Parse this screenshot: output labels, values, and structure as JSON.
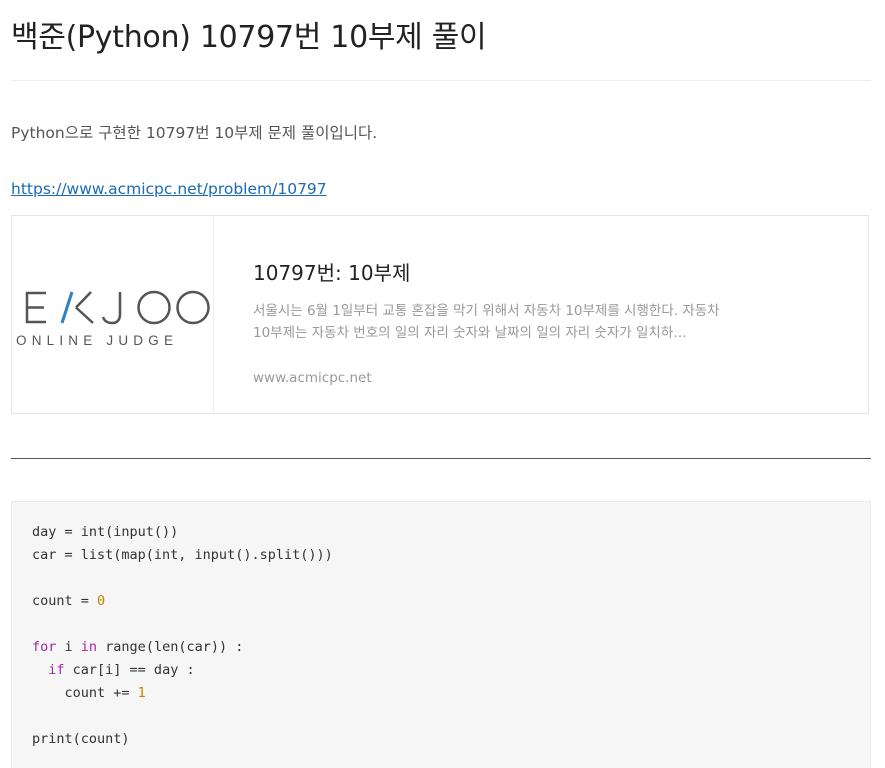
{
  "post": {
    "title": "백준(Python) 10797번 10부제 풀이",
    "intro": "Python으로 구현한 10797번 10부제 문제 풀이입니다.",
    "link_text": "https://www.acmicpc.net/problem/10797"
  },
  "og_card": {
    "logo_text": "EKJOO",
    "logo_subtext": "ONLINE JUDGE",
    "title": "10797번: 10부제",
    "description": "서울시는 6월 1일부터 교통 혼잡을 막기 위해서 자동차 10부제를 시행한다. 자동차 10부제는 자동차 번호의 일의 자리 숫자와 날짜의 일의 자리 숫자가 일치하…",
    "domain": "www.acmicpc.net"
  },
  "code": {
    "lines": [
      {
        "parts": [
          {
            "t": "day = int(input())",
            "c": ""
          }
        ]
      },
      {
        "parts": [
          {
            "t": "car = list(map(int, input().split()))",
            "c": ""
          }
        ]
      },
      {
        "parts": [
          {
            "t": "",
            "c": ""
          }
        ]
      },
      {
        "parts": [
          {
            "t": "count = ",
            "c": ""
          },
          {
            "t": "0",
            "c": "num"
          }
        ]
      },
      {
        "parts": [
          {
            "t": "",
            "c": ""
          }
        ]
      },
      {
        "parts": [
          {
            "t": "for",
            "c": "kw"
          },
          {
            "t": " i ",
            "c": ""
          },
          {
            "t": "in",
            "c": "kw"
          },
          {
            "t": " range(len(car)) :",
            "c": ""
          }
        ]
      },
      {
        "parts": [
          {
            "t": "  ",
            "c": ""
          },
          {
            "t": "if",
            "c": "kw"
          },
          {
            "t": " car[i] == day :",
            "c": ""
          }
        ]
      },
      {
        "parts": [
          {
            "t": "    count += ",
            "c": ""
          },
          {
            "t": "1",
            "c": "num"
          }
        ]
      },
      {
        "parts": [
          {
            "t": "",
            "c": ""
          }
        ]
      },
      {
        "parts": [
          {
            "t": "print(count)",
            "c": ""
          }
        ]
      }
    ]
  },
  "colors": {
    "link": "#1a6ab5",
    "keyword": "#a626a4",
    "number": "#c18401",
    "logo_gray": "#555555",
    "logo_blue": "#2f7fc1"
  }
}
